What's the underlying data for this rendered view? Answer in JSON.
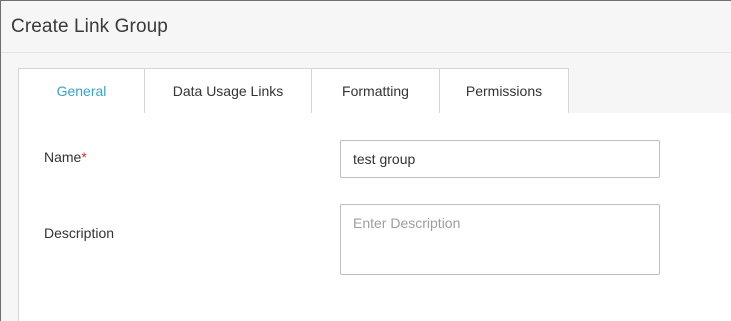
{
  "dialog": {
    "title": "Create Link Group"
  },
  "tabs": [
    {
      "label": "General",
      "active": true
    },
    {
      "label": "Data Usage Links",
      "active": false
    },
    {
      "label": "Formatting",
      "active": false
    },
    {
      "label": "Permissions",
      "active": false
    }
  ],
  "form": {
    "name_label": "Name",
    "required_marker": "*",
    "name_value": "test group",
    "description_label": "Description",
    "description_placeholder": "Enter Description",
    "description_value": ""
  },
  "colors": {
    "active_tab_text": "#3aa1c4",
    "required_marker": "#d0312d",
    "background": "#f6f6f6",
    "panel": "#ffffff"
  }
}
